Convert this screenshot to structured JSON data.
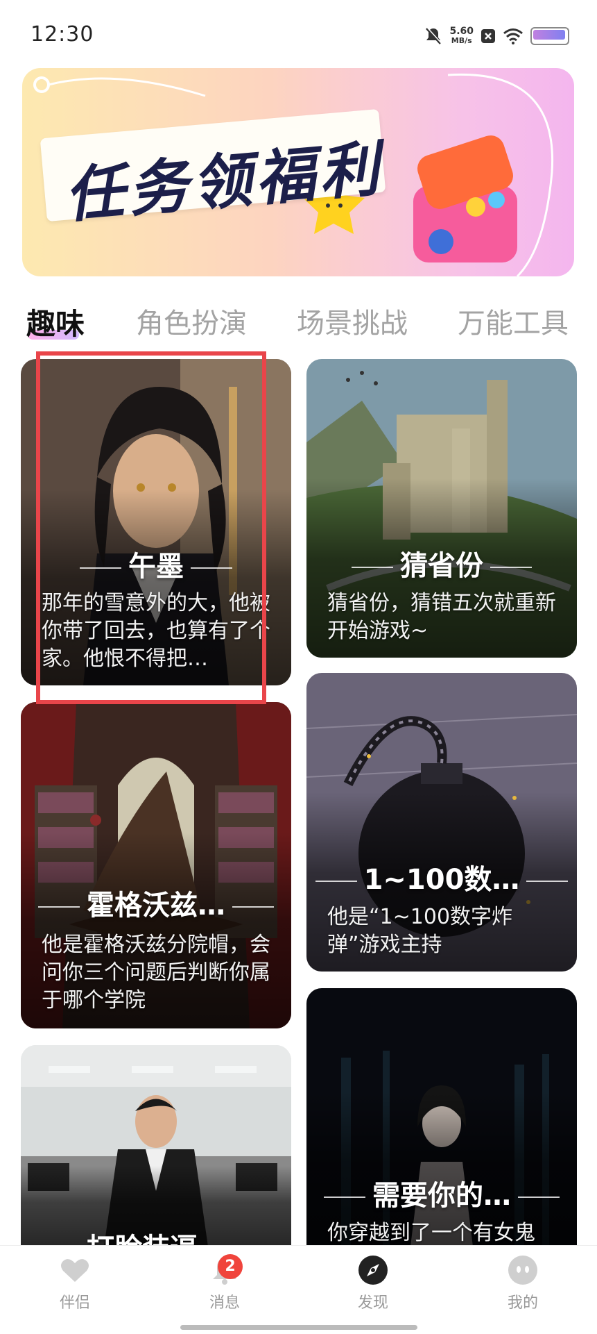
{
  "status_bar": {
    "time": "12:30",
    "net_speed_value": "5.60",
    "net_speed_unit": "MB/s",
    "icons": [
      "mute-bell-icon",
      "close-box-icon",
      "wifi-icon",
      "battery-icon"
    ]
  },
  "banner": {
    "title": "任务领福利"
  },
  "tabs": [
    {
      "label": "趣味",
      "active": true
    },
    {
      "label": "角色扮演",
      "active": false
    },
    {
      "label": "场景挑战",
      "active": false
    },
    {
      "label": "万能工具",
      "active": false
    }
  ],
  "cards": [
    {
      "title": "午墨",
      "desc": "那年的雪意外的大，他被你带了回去，也算有了个家。他恨不得把…",
      "art": "anime-man-portrait"
    },
    {
      "title": "猜省份",
      "desc": "猜省份，猜错五次就重新开始游戏~",
      "art": "castle-landscape"
    },
    {
      "title": "霍格沃兹…",
      "desc": "他是霍格沃兹分院帽，会问你三个问题后判断你属于哪个学院",
      "art": "sorting-hat-library"
    },
    {
      "title": "1~100数…",
      "desc": "他是“1~100数字炸弹”游戏主持",
      "art": "bomb-sketch"
    },
    {
      "title": "打脸装逼…",
      "desc": "",
      "art": "office-man-suit"
    },
    {
      "title": "需要你的…",
      "desc": "你穿越到了一个有女鬼",
      "art": "ghost-woman-dark"
    }
  ],
  "bottom_nav": [
    {
      "label": "伴侣",
      "icon": "heart-icon",
      "active": false
    },
    {
      "label": "消息",
      "icon": "bell-icon",
      "active": false,
      "badge": "2"
    },
    {
      "label": "发现",
      "icon": "compass-icon",
      "active": true
    },
    {
      "label": "我的",
      "icon": "face-icon",
      "active": false
    }
  ],
  "colors": {
    "highlight_box": "#e9454a",
    "badge": "#f0443c",
    "tab_active": "#111111",
    "tab_inactive": "#a3a3a3"
  }
}
